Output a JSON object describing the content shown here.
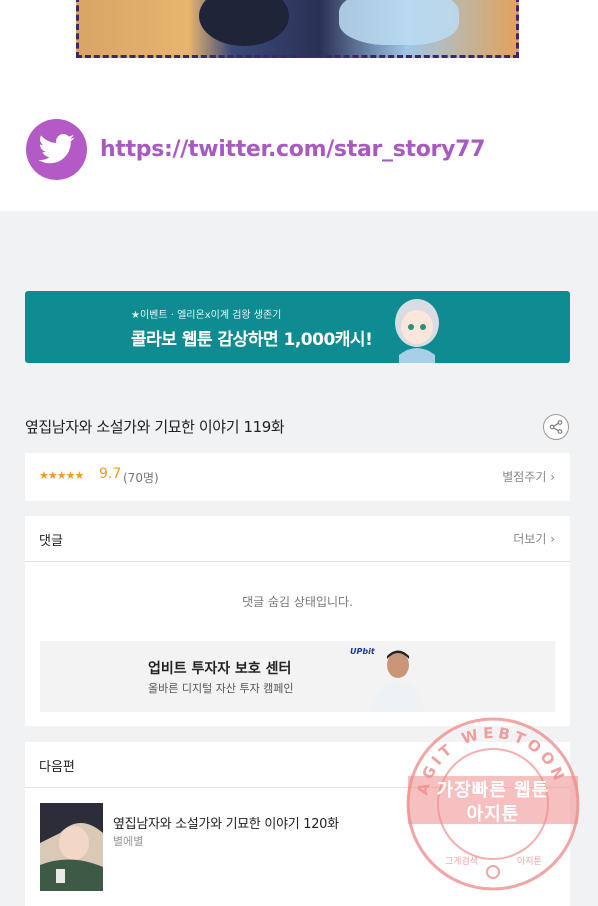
{
  "twitter": {
    "url_text": "https://twitter.com/star_story77"
  },
  "banner": {
    "small_text": "★이벤트 · 엘리온x이계 검왕 생존기",
    "big_text": "콜라보 웹툰 감상하면 1,000캐시!"
  },
  "episode": {
    "title": "옆집남자와 소설가와 기묘한 이야기 119화"
  },
  "rating": {
    "stars": "★★★★★",
    "score": "9.7",
    "count": "(70명)",
    "rate_button": "별점주기 ›"
  },
  "comments": {
    "heading": "댓글",
    "more": "더보기 ›",
    "hidden_message": "댓글 숨김 상태입니다."
  },
  "ad": {
    "logo": "UPbit",
    "title": "업비트 투자자 보호 센터",
    "subtitle": "올바른 디지털 자산 투자 캠페인"
  },
  "next": {
    "heading": "다음편",
    "title": "옆집남자와 소설가와 기묘한 이야기 120화",
    "subtitle": "별에별"
  },
  "watermark": {
    "ring_text": "AGIT WEBTOON",
    "line1": "가장빠른 웹툰",
    "line2": "아지툰",
    "bottom_left": "그게검색",
    "bottom_right": "아지툰"
  }
}
